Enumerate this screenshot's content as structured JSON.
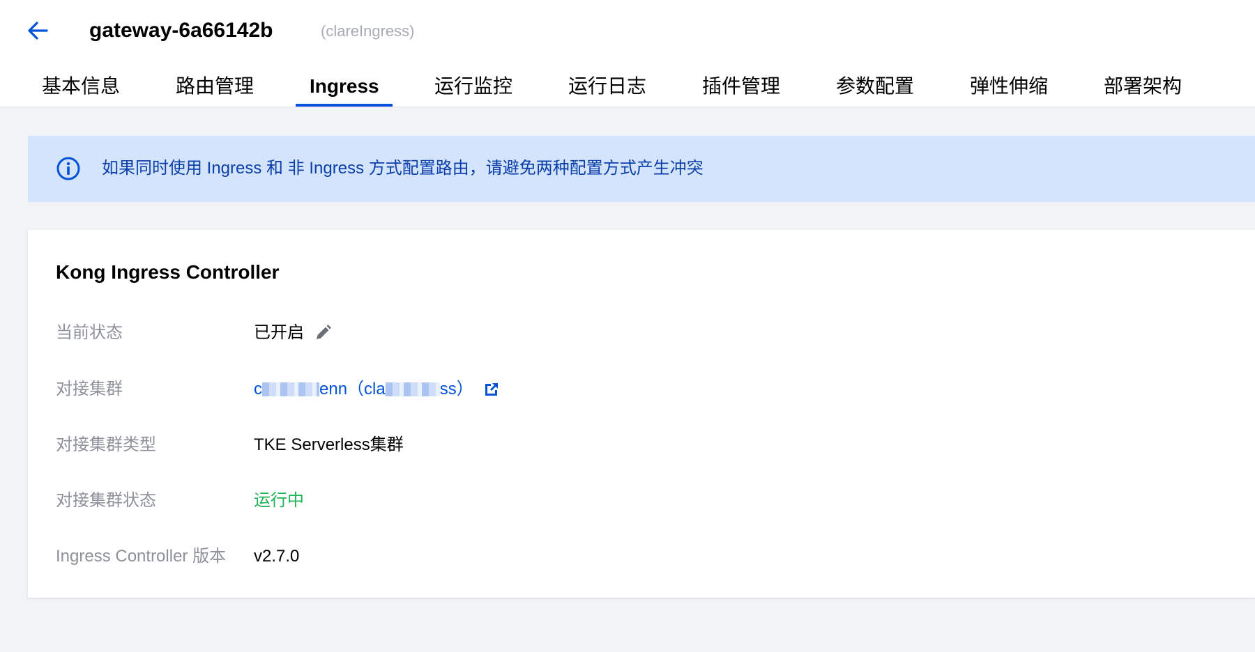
{
  "header": {
    "title": "gateway-6a66142b",
    "subtitle": "(clareIngress)"
  },
  "tabs": [
    {
      "label": "基本信息",
      "active": false
    },
    {
      "label": "路由管理",
      "active": false
    },
    {
      "label": "Ingress",
      "active": true
    },
    {
      "label": "运行监控",
      "active": false
    },
    {
      "label": "运行日志",
      "active": false
    },
    {
      "label": "插件管理",
      "active": false
    },
    {
      "label": "参数配置",
      "active": false
    },
    {
      "label": "弹性伸缩",
      "active": false
    },
    {
      "label": "部署架构",
      "active": false
    }
  ],
  "notice": {
    "message": "如果同时使用 Ingress 和 非 Ingress 方式配置路由，请避免两种配置方式产生冲突"
  },
  "card": {
    "title": "Kong Ingress Controller",
    "rows": [
      {
        "label": "当前状态",
        "value": "已开启"
      },
      {
        "label": "对接集群",
        "value_start": "c",
        "value_mid": "enn（cla",
        "value_end": "ss）"
      },
      {
        "label": "对接集群类型",
        "value": "TKE Serverless集群"
      },
      {
        "label": "对接集群状态",
        "value": "运行中"
      },
      {
        "label": "Ingress Controller 版本",
        "value": "v2.7.0"
      }
    ]
  },
  "colors": {
    "accent": "#0052d9",
    "notice_bg": "#d4e4fc",
    "running_green": "#1fb45a",
    "page_bg": "#f2f3f6"
  },
  "icons": {
    "back": "arrow-left-icon",
    "info": "info-circle-icon",
    "edit": "pencil-icon",
    "external": "external-link-icon"
  }
}
